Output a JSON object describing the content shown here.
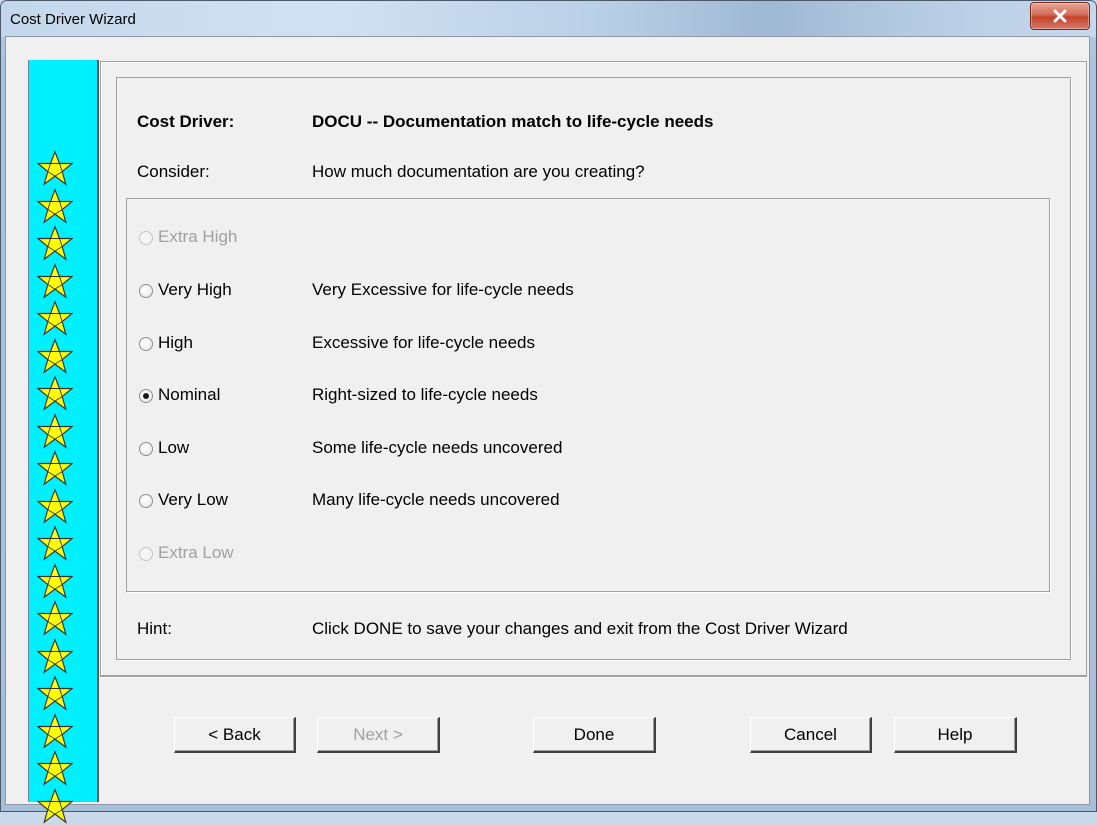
{
  "window": {
    "title": "Cost Driver Wizard"
  },
  "header": {
    "driver_label": "Cost Driver:",
    "driver_value": "DOCU -- Documentation match to life-cycle needs",
    "consider_label": "Consider:",
    "consider_value": "How much documentation are you creating?"
  },
  "ratings": [
    {
      "label": "Extra High",
      "description": "",
      "enabled": false,
      "checked": false
    },
    {
      "label": "Very High",
      "description": "Very Excessive for life-cycle needs",
      "enabled": true,
      "checked": false
    },
    {
      "label": "High",
      "description": "Excessive for life-cycle needs",
      "enabled": true,
      "checked": false
    },
    {
      "label": "Nominal",
      "description": "Right-sized to life-cycle needs",
      "enabled": true,
      "checked": true
    },
    {
      "label": "Low",
      "description": "Some life-cycle needs uncovered",
      "enabled": true,
      "checked": false
    },
    {
      "label": "Very Low",
      "description": "Many life-cycle needs uncovered",
      "enabled": true,
      "checked": false
    },
    {
      "label": "Extra Low",
      "description": "",
      "enabled": false,
      "checked": false
    }
  ],
  "hint": {
    "label": "Hint:",
    "text": "Click DONE to save your changes and exit from the Cost Driver Wizard"
  },
  "buttons": {
    "back": "< Back",
    "next": "Next >",
    "done": "Done",
    "cancel": "Cancel",
    "help": "Help"
  },
  "colors": {
    "star_strip": "#00f0ff",
    "star_fill": "#ffff00",
    "close_button": "#c3412a"
  },
  "icons": {
    "close": "close-icon",
    "star": "star-icon"
  }
}
